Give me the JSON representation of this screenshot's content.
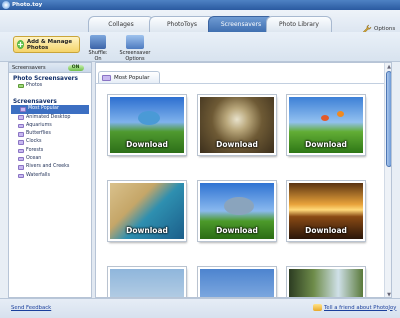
{
  "window": {
    "title": "Photo.toy"
  },
  "tabs": [
    {
      "label": "Collages"
    },
    {
      "label": "PhotoToys"
    },
    {
      "label": "Screensavers"
    },
    {
      "label": "Photo Library"
    }
  ],
  "header": {
    "options_label": "Options"
  },
  "toolbar": {
    "add_label": "Add & Manage Photos",
    "shuffle_label": "Shuffle: On",
    "screensaver_options_label": "Screensaver Options"
  },
  "sidebar": {
    "screensavers_toggle_label": "Screensavers",
    "toggle_state": "ON",
    "photo_screensavers_heading": "Photo Screensavers",
    "photo_items": [
      {
        "label": "Photos"
      }
    ],
    "screensavers_heading": "Screensavers",
    "items": [
      {
        "label": "Most Popular"
      },
      {
        "label": "Animated Desktop"
      },
      {
        "label": "Aquariums"
      },
      {
        "label": "Butterflies"
      },
      {
        "label": "Clocks"
      },
      {
        "label": "Forests"
      },
      {
        "label": "Ocean"
      },
      {
        "label": "Rivers and Creeks"
      },
      {
        "label": "Waterfalls"
      }
    ]
  },
  "main": {
    "section_label": "Most Popular",
    "download_label": "Download",
    "thumbnails": [
      {
        "subject": "fish-meadow"
      },
      {
        "subject": "clock"
      },
      {
        "subject": "butterflies-meadow"
      },
      {
        "subject": "beach"
      },
      {
        "subject": "dolphin"
      },
      {
        "subject": "sunset-ocean"
      },
      {
        "subject": "partial-1"
      },
      {
        "subject": "partial-2"
      },
      {
        "subject": "partial-3"
      }
    ]
  },
  "statusbar": {
    "send_feedback": "Send Feedback",
    "tell_friend": "Tell a friend about PhotoJoy"
  },
  "colors": {
    "accent": "#3c6fc2",
    "link": "#1a3f9c"
  }
}
